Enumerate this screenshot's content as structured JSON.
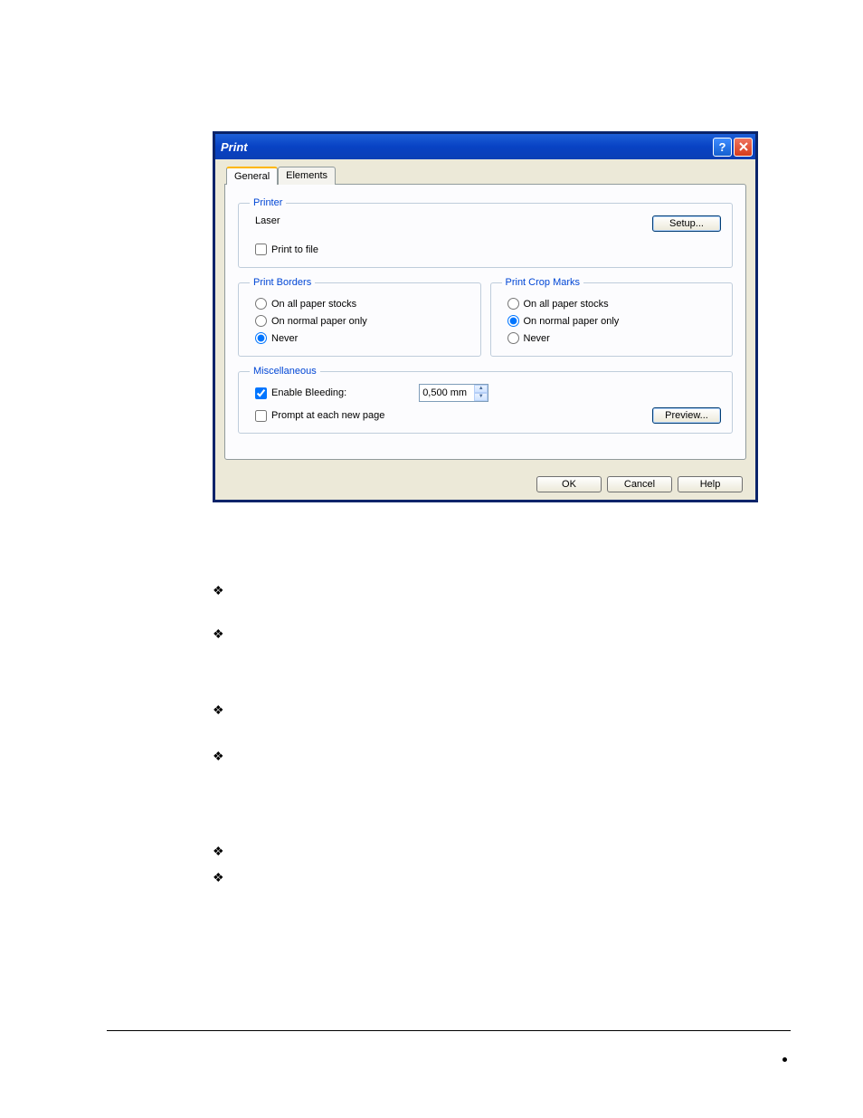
{
  "dialog": {
    "title": "Print",
    "tabs": [
      "General",
      "Elements"
    ]
  },
  "printer": {
    "legend": "Printer",
    "name": "Laser",
    "setup_btn": "Setup...",
    "print_to_file": "Print to file"
  },
  "borders": {
    "legend": "Print Borders",
    "opt1": "On all paper stocks",
    "opt2": "On normal paper only",
    "opt3": "Never",
    "selected": "opt3"
  },
  "crop": {
    "legend": "Print Crop Marks",
    "opt1": "On all paper stocks",
    "opt2": "On normal paper only",
    "opt3": "Never",
    "selected": "opt2"
  },
  "misc": {
    "legend": "Miscellaneous",
    "enable_bleeding": "Enable Bleeding:",
    "bleed_value": "0,500 mm",
    "prompt": "Prompt at each new page",
    "preview_btn": "Preview..."
  },
  "buttons": {
    "ok": "OK",
    "cancel": "Cancel",
    "help": "Help"
  }
}
